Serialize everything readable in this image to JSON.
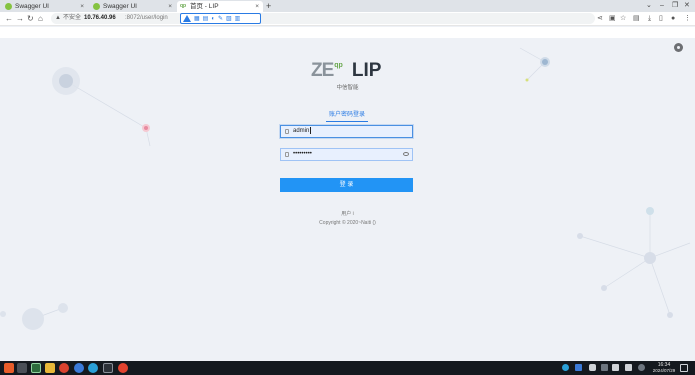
{
  "browser": {
    "tabs": [
      {
        "title": "Swagger UI",
        "icon": "swagger-icon"
      },
      {
        "title": "Swagger UI",
        "icon": "swagger-icon"
      },
      {
        "title": "首页 - LIP",
        "icon": "lip-icon"
      }
    ],
    "new_tab": "+",
    "close_glyph": "×",
    "address": {
      "security": "不安全",
      "host": "10.76.40.96",
      "path": ":8072/user/login"
    }
  },
  "page": {
    "logo": {
      "brand": "ZE",
      "brand_sup": "qp",
      "product": "LIP"
    },
    "subtitle": "中信智能",
    "login_tab": "账户密码登录",
    "username": {
      "value": "admin"
    },
    "password": {
      "value": "•••••••••"
    },
    "submit_label": "登 录",
    "footer": {
      "line1": "用户 i",
      "line2": "Copyright © 2020~Naiti ()"
    }
  },
  "taskbar": {
    "time": "16:34",
    "date": "2024/07/29"
  },
  "colors": {
    "accent": "#2294f5",
    "page_bg": "#eef1f6",
    "taskbar_bg": "#14191f",
    "brand_green": "#6aa84f"
  }
}
